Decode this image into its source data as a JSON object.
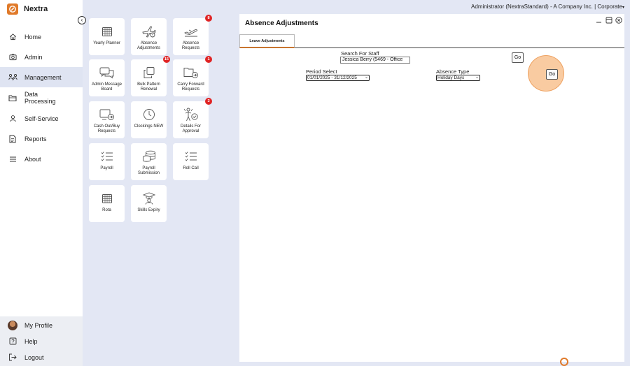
{
  "app": {
    "brand": "Nextra",
    "accent_color": "#e07a2a",
    "badge_color": "#e02424"
  },
  "topbar": {
    "user_text": "Administrator (NextraStandard) - A Company Inc. | Corporate"
  },
  "sidebar": {
    "items": [
      {
        "label": "Home",
        "icon": "home-icon"
      },
      {
        "label": "Admin",
        "icon": "camera-icon"
      },
      {
        "label": "Management",
        "icon": "management-icon",
        "active": true
      },
      {
        "label": "Data Processing",
        "icon": "folder-icon"
      },
      {
        "label": "Self-Service",
        "icon": "person-icon"
      },
      {
        "label": "Reports",
        "icon": "report-icon"
      },
      {
        "label": "About",
        "icon": "menu-icon"
      }
    ],
    "bottom": [
      {
        "label": "My Profile",
        "icon": "avatar"
      },
      {
        "label": "Help",
        "icon": "help-icon"
      },
      {
        "label": "Logout",
        "icon": "logout-icon"
      }
    ]
  },
  "tiles": [
    {
      "label": "Yearly Planner",
      "icon": "calendar-icon",
      "badge": ""
    },
    {
      "label": "Absence Adjustments",
      "icon": "plane-alert-icon",
      "badge": ""
    },
    {
      "label": "Absence Requests",
      "icon": "plane-takeoff-icon",
      "badge": "8"
    },
    {
      "label": "Admin Message Board",
      "icon": "chat-icon",
      "badge": ""
    },
    {
      "label": "Bulk Pattern Renewal",
      "icon": "copy-icon",
      "badge": "15"
    },
    {
      "label": "Carry Forward Requests",
      "icon": "folder-arrow-icon",
      "badge": "1"
    },
    {
      "label": "Cash Out/Buy Requests",
      "icon": "screen-arrow-icon",
      "badge": ""
    },
    {
      "label": "Clockings NEW",
      "icon": "clock-icon",
      "badge": ""
    },
    {
      "label": "Details For Approval",
      "icon": "person-check-icon",
      "badge": "3"
    },
    {
      "label": "Payroll",
      "icon": "checklist-icon",
      "badge": ""
    },
    {
      "label": "Payroll Submission",
      "icon": "coins-icon",
      "badge": ""
    },
    {
      "label": "Roll Call",
      "icon": "checklist-icon",
      "badge": ""
    },
    {
      "label": "Rota",
      "icon": "calendar-icon",
      "badge": ""
    },
    {
      "label": "Skills Expiry",
      "icon": "graduation-icon",
      "badge": ""
    }
  ],
  "panel": {
    "title": "Absence Adjustments",
    "tabs": [
      {
        "label": "Leave Adjustments",
        "active": true
      }
    ],
    "search": {
      "label": "Search For Staff",
      "value": "Jessica Berry (5469 - Office"
    },
    "period": {
      "label": "Period Select",
      "value": "01/01/2025 - 31/12/2025"
    },
    "absence_type": {
      "label": "Absence Type",
      "value": "Holiday Days"
    },
    "go_label": "Go",
    "go_label_2": "Go"
  }
}
